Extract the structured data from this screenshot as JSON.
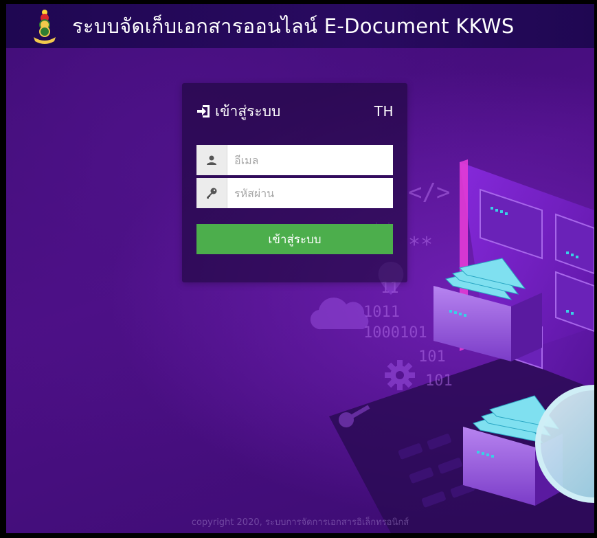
{
  "header": {
    "title": "ระบบจัดเก็บเอกสารออนไลน์ E-Document KKWS"
  },
  "login": {
    "heading": "เข้าสู่ระบบ",
    "language": "TH",
    "email_placeholder": "อีเมล",
    "email_value": "",
    "password_placeholder": "รหัสผ่าน",
    "password_value": "",
    "submit_label": "เข้าสู่ระบบ"
  },
  "footer": {
    "copyright": "copyright 2020, ระบบการจัดการเอกสารอิเล็กทรอนิกส์"
  },
  "icons": {
    "logo": "school-emblem-icon",
    "login": "sign-in-icon",
    "user": "user-icon",
    "key": "key-icon"
  },
  "colors": {
    "background": "#4c0f85",
    "topbar": "#290a60",
    "button": "#4cae4c",
    "accent_cyan": "#39d0e6",
    "accent_pink": "#e23bd6"
  }
}
